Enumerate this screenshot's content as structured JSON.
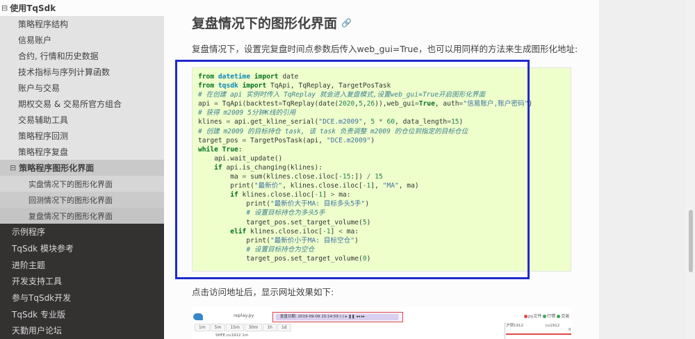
{
  "sidebar": {
    "top_item": {
      "toggle": "⊟",
      "label": "使用TqSdk"
    },
    "level2": [
      "策略程序结构",
      "信易账户",
      "合约, 行情和历史数据",
      "技术指标与序列计算函数",
      "账户与交易",
      "期权交易 & 交易所官方组合",
      "交易辅助工具",
      "策略程序回测",
      "策略程序复盘"
    ],
    "current": {
      "toggle": "⊟",
      "label": "策略程序图形化界面"
    },
    "level3": [
      "实盘情况下的图形化界面",
      "回测情况下的图形化界面",
      "复盘情况下的图形化界面"
    ],
    "level1": [
      "示例程序",
      "TqSdk 模块参考",
      "进阶主题",
      "开发支持工具",
      "参与TqSdk开发",
      "TqSdk 专业版",
      "天勤用户论坛"
    ]
  },
  "content": {
    "heading": "复盘情况下的图形化界面",
    "heading_link_icon": "🔗",
    "paragraph1": "复盘情况下，设置完复盘时间点参数后传入web_gui=True，也可以用同样的方法来生成图形化地址:",
    "paragraph2": "点击访问地址后，显示网址效果如下:"
  },
  "preview": {
    "file_name": "replay.py",
    "replay_label": "复盘日期: 2019-09-09 15:14:59 (-)",
    "controls": "▸ ❚❚ ◂◂ ▸▸",
    "legend": [
      "py文件",
      "行情",
      "交易"
    ],
    "legend_colors": [
      "#e04848",
      "#3aa657",
      "#3aa657"
    ],
    "periods": [
      "1m",
      "5m",
      "15m",
      "30m",
      "1h",
      "1d"
    ],
    "symbol": "SHFE.cu1912 1m",
    "table_headers": [
      "沪铜1912",
      "cu1912"
    ],
    "table_row": [
      "",
      "0"
    ]
  },
  "colors": {
    "sidebar_bg": "#343131",
    "code_bg": "#eeffcc",
    "focus_border": "#1f2acb"
  }
}
